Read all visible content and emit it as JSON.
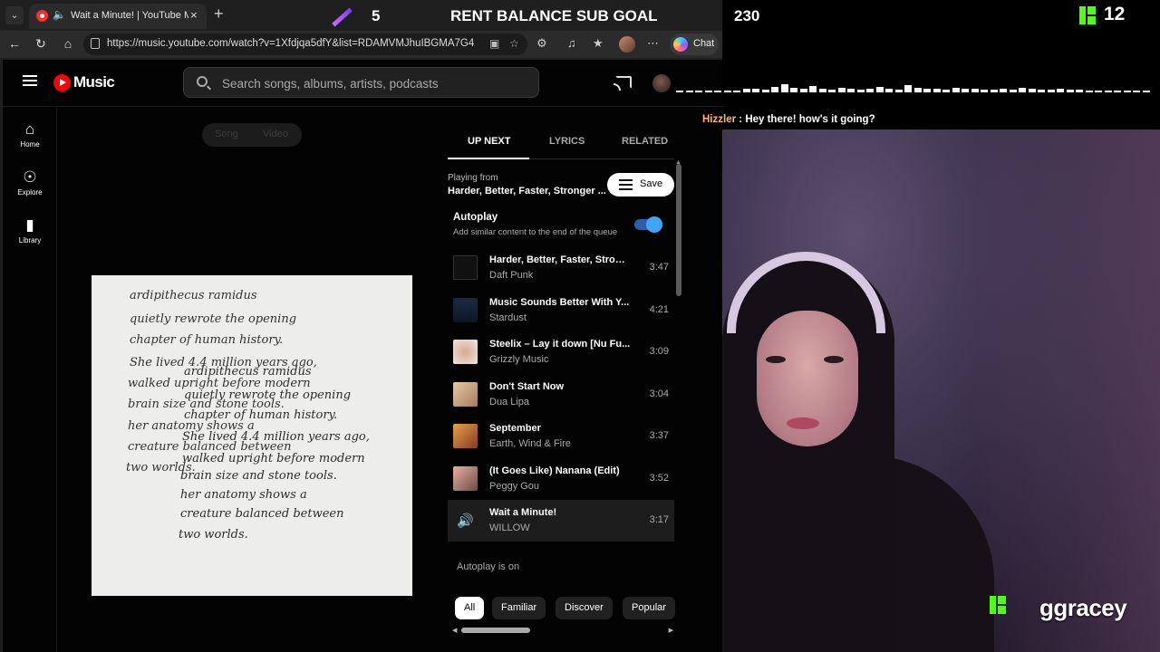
{
  "browser": {
    "tab_title": "Wait a Minute! | YouTube Music",
    "url": "https://music.youtube.com/watch?v=1Xfdjqa5dfY&list=RDAMVMJhuIBGMA7G4",
    "chat_label": "Chat"
  },
  "ytm": {
    "logo_text": "Music",
    "search_placeholder": "Search songs, albums, artists, podcasts",
    "nav": [
      {
        "label": "Home",
        "icon": "home-icon"
      },
      {
        "label": "Explore",
        "icon": "explore-icon"
      },
      {
        "label": "Library",
        "icon": "library-icon"
      }
    ],
    "toggle": {
      "song": "Song",
      "video": "Video"
    },
    "tabs": [
      "UP NEXT",
      "LYRICS",
      "RELATED"
    ],
    "active_tab": "UP NEXT",
    "playing_from_label": "Playing from",
    "playing_from_value": "Harder, Better, Faster, Stronger ...",
    "save_label": "Save",
    "autoplay_title": "Autoplay",
    "autoplay_desc": "Add similar content to the end of the queue",
    "autoplay_enabled": true,
    "queue": [
      {
        "title": "Harder, Better, Faster, Strong...",
        "artist": "Daft Punk",
        "duration": "3:47"
      },
      {
        "title": "Music Sounds Better With Y...",
        "artist": "Stardust",
        "duration": "4:21"
      },
      {
        "title": "Steelix – Lay it down [Nu Fu...",
        "artist": "Grizzly Music",
        "duration": "3:09"
      },
      {
        "title": "Don't Start Now",
        "artist": "Dua Lipa",
        "duration": "3:04"
      },
      {
        "title": "September",
        "artist": "Earth, Wind & Fire",
        "duration": "3:37"
      },
      {
        "title": "(It Goes Like) Nanana (Edit)",
        "artist": "Peggy Gou",
        "duration": "3:52"
      },
      {
        "title": "Wait a Minute!",
        "artist": "WILLOW",
        "duration": "3:17"
      }
    ],
    "autoplay_on_text": "Autoplay is on",
    "chips": [
      "All",
      "Familiar",
      "Discover",
      "Popular"
    ],
    "active_chip": "All",
    "art_text": [
      "ardipithecus ramidus",
      "quietly rewrote the opening",
      "chapter of human history.",
      "She lived 4.4 million years ago,",
      "walked upright before modern",
      "brain size and stone tools.",
      "her anatomy shows a",
      "creature balanced between",
      "two worlds."
    ]
  },
  "overlay": {
    "goal_current": "5",
    "goal_title": "RENT BALANCE SUB GOAL",
    "goal_target": "230",
    "viewer_count": "12",
    "chat_user": "Hizzler",
    "chat_sep": " : ",
    "chat_message": "Hey there! how's it going?",
    "streamer_handle": "ggracey",
    "brand_color": "#53fc18"
  }
}
